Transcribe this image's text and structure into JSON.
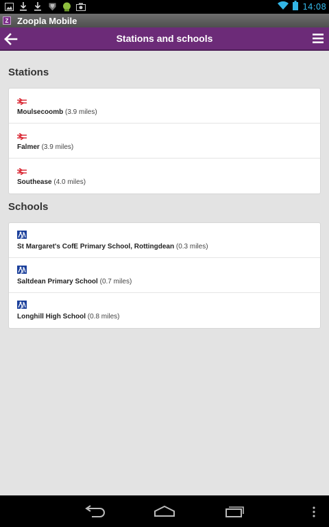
{
  "status_bar": {
    "time": "14:08",
    "icons": [
      "image-icon",
      "download-icon",
      "download-icon",
      "shield-icon",
      "android-icon",
      "camera-icon"
    ]
  },
  "app": {
    "title": "Zoopla Mobile",
    "logo_letter": "Z"
  },
  "action_bar": {
    "title": "Stations and schools"
  },
  "stations": {
    "heading": "Stations",
    "items": [
      {
        "name": "Moulsecoomb",
        "distance": "(3.9 miles)"
      },
      {
        "name": "Falmer",
        "distance": "(3.9 miles)"
      },
      {
        "name": "Southease",
        "distance": "(4.0 miles)"
      }
    ]
  },
  "schools": {
    "heading": "Schools",
    "items": [
      {
        "name": "St Margaret's CofE Primary School, Rottingdean",
        "distance": "(0.3 miles)"
      },
      {
        "name": "Saltdean Primary School",
        "distance": "(0.7 miles)"
      },
      {
        "name": "Longhill High School",
        "distance": "(0.8 miles)"
      }
    ]
  },
  "colors": {
    "action_bar": "#6c2b78",
    "rail_icon": "#d8202c",
    "school_icon": "#1a3f9b",
    "clock": "#33b5e5"
  }
}
